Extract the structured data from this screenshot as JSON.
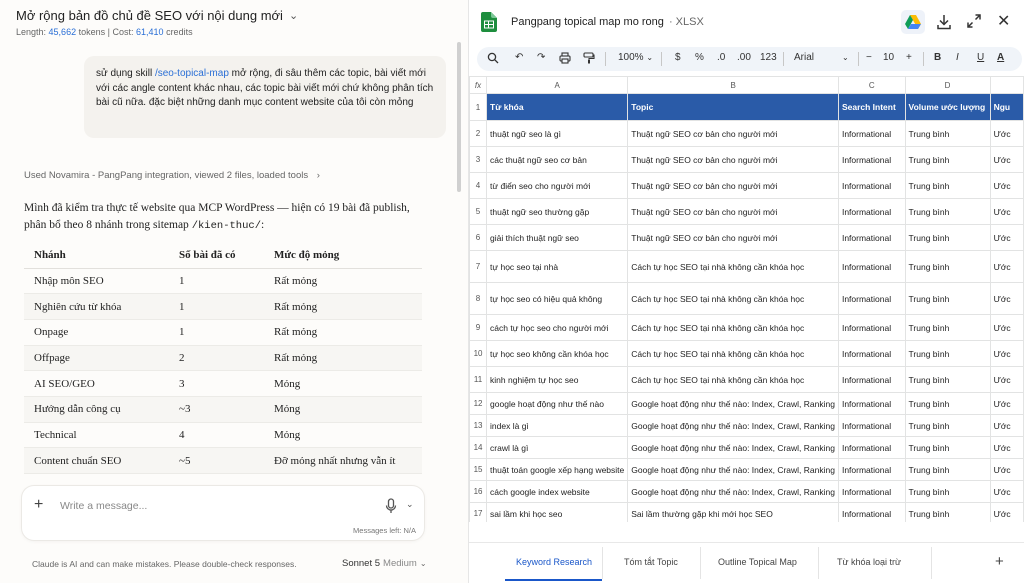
{
  "chat": {
    "title": "Mở rộng bản đồ chủ đề SEO với nội dung mới",
    "meta": {
      "length_label": "Length:",
      "tokens": "45,662",
      "tokens_unit": "tokens",
      "sep": "| Cost:",
      "credits": "61,410",
      "credits_unit": "credits"
    },
    "user_message": {
      "before": "sử dụng skill ",
      "skill": "/seo-topical-map",
      "after": " mở rộng, đi sâu thêm các topic, bài viết mới với các angle content khác nhau, các topic bài viết mới chứ không phân tích bài cũ nữa. đặc biệt những danh mục content website của tôi còn mỏng"
    },
    "tools_line": "Used Novamira - PangPang integration, viewed 2 files, loaded tools",
    "intro_text": "Mình đã kiểm tra thực tế website qua MCP WordPress — hiện có 19 bài đã publish, phân bổ theo 8 nhánh trong sitemap ",
    "intro_code": "/kien-thuc/",
    "intro_end": ":",
    "table": {
      "headers": [
        "Nhánh",
        "Số bài đã có",
        "Mức độ mỏng"
      ],
      "rows": [
        [
          "Nhập môn SEO",
          "1",
          "Rất mỏng"
        ],
        [
          "Nghiên cứu từ khóa",
          "1",
          "Rất mỏng"
        ],
        [
          "Onpage",
          "1",
          "Rất mỏng"
        ],
        [
          "Offpage",
          "2",
          "Rất mỏng"
        ],
        [
          "AI SEO/GEO",
          "3",
          "Mỏng"
        ],
        [
          "Hướng dẫn công cụ",
          "~3",
          "Mỏng"
        ],
        [
          "Technical",
          "4",
          "Mỏng"
        ],
        [
          "Content chuẩn SEO",
          "~5",
          "Đỡ mỏng nhất nhưng vẫn ít"
        ]
      ]
    },
    "composer": {
      "placeholder": "Write a message...",
      "messages_left": "Messages left: N/A"
    },
    "disclaimer": "Claude is AI and can make mistakes. Please double-check responses.",
    "model": {
      "name": "Sonnet 5",
      "mode": "Medium"
    }
  },
  "sheet": {
    "file_name": "Pangpang topical map mo rong",
    "file_ext": "· XLSX",
    "toolbar": {
      "zoom": "100%",
      "currency": "$",
      "percent": "%",
      "dec_down": ".0",
      "dec_up": ".00",
      "number_fmt": "123",
      "font": "Arial",
      "minus": "−",
      "font_size": "10",
      "plus": "+",
      "bold": "B",
      "italic": "I",
      "underline": "U",
      "text_color": "A"
    },
    "fx_label": "fx",
    "columns": [
      "A",
      "B",
      "C",
      "D",
      ""
    ],
    "header_row": [
      "Từ khóa",
      "Topic",
      "Search Intent",
      "Volume ước lượng",
      "Ngu"
    ],
    "rows": [
      [
        "2",
        "thuật ngữ seo là gì",
        "Thuật ngữ SEO cơ bản cho người mới",
        "Informational",
        "Trung bình",
        "Ước"
      ],
      [
        "3",
        "các thuật ngữ seo cơ bản",
        "Thuật ngữ SEO cơ bản cho người mới",
        "Informational",
        "Trung bình",
        "Ước"
      ],
      [
        "4",
        "từ điển seo cho người mới",
        "Thuật ngữ SEO cơ bản cho người mới",
        "Informational",
        "Trung bình",
        "Ước"
      ],
      [
        "5",
        "thuật ngữ seo thường gặp",
        "Thuật ngữ SEO cơ bản cho người mới",
        "Informational",
        "Trung bình",
        "Ước"
      ],
      [
        "6",
        "giải thích thuật ngữ seo",
        "Thuật ngữ SEO cơ bản cho người mới",
        "Informational",
        "Trung bình",
        "Ước"
      ],
      [
        "7",
        "tự học seo tại nhà",
        "Cách tự học SEO tại nhà không cần khóa học",
        "Informational",
        "Trung bình",
        "Ước"
      ],
      [
        "8",
        "tự học seo có hiệu quả không",
        "Cách tự học SEO tại nhà không cần khóa học",
        "Informational",
        "Trung bình",
        "Ước"
      ],
      [
        "9",
        "cách tự học seo cho người mới",
        "Cách tự học SEO tại nhà không cần khóa học",
        "Informational",
        "Trung bình",
        "Ước"
      ],
      [
        "10",
        "tự học seo không cần khóa học",
        "Cách tự học SEO tại nhà không cần khóa học",
        "Informational",
        "Trung bình",
        "Ước"
      ],
      [
        "11",
        "kinh nghiệm tự học seo",
        "Cách tự học SEO tại nhà không cần khóa học",
        "Informational",
        "Trung bình",
        "Ước"
      ],
      [
        "12",
        "google hoạt động như thế nào",
        "Google hoạt động như thế nào: Index, Crawl, Ranking",
        "Informational",
        "Trung bình",
        "Ước"
      ],
      [
        "13",
        "index là gì",
        "Google hoạt động như thế nào: Index, Crawl, Ranking",
        "Informational",
        "Trung bình",
        "Ước"
      ],
      [
        "14",
        "crawl là gì",
        "Google hoạt động như thế nào: Index, Crawl, Ranking",
        "Informational",
        "Trung bình",
        "Ước"
      ],
      [
        "15",
        "thuật toán google xếp hạng website",
        "Google hoạt động như thế nào: Index, Crawl, Ranking",
        "Informational",
        "Trung bình",
        "Ước"
      ],
      [
        "16",
        "cách google index website",
        "Google hoạt động như thế nào: Index, Crawl, Ranking",
        "Informational",
        "Trung bình",
        "Ước"
      ],
      [
        "17",
        "sai lầm khi học seo",
        "Sai lầm thường gặp khi mới học SEO",
        "Informational",
        "Trung bình",
        "Ước"
      ]
    ],
    "tabs": [
      "Keyword Research",
      "Tóm tắt Topic",
      "Outline Topical Map",
      "Từ khóa loại trừ"
    ],
    "add_tab": "+"
  }
}
